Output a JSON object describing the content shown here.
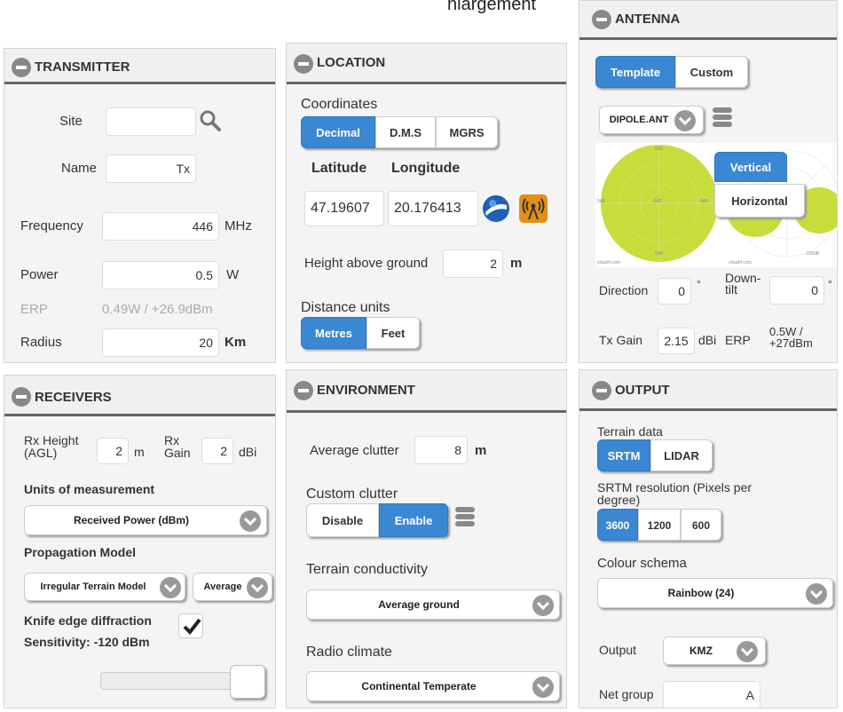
{
  "top_title": "nlargement",
  "transmitter": {
    "title": "TRANSMITTER",
    "site_label": "Site",
    "site_value": "",
    "name_label": "Name",
    "name_value": "Tx",
    "frequency_label": "Frequency",
    "frequency_value": "446",
    "frequency_unit": "MHz",
    "power_label": "Power",
    "power_value": "0.5",
    "power_unit": "W",
    "erp_label": "ERP",
    "erp_value": "0.49W / +26.9dBm",
    "radius_label": "Radius",
    "radius_value": "20",
    "radius_unit": "Km"
  },
  "location": {
    "title": "LOCATION",
    "coordinates_label": "Coordinates",
    "coord_modes": [
      "Decimal",
      "D.M.S",
      "MGRS"
    ],
    "coord_mode_selected": "Decimal",
    "latitude_label": "Latitude",
    "longitude_label": "Longitude",
    "latitude_value": "47.19607",
    "longitude_value": "20.176413",
    "height_label": "Height above ground",
    "height_value": "2",
    "height_unit": "m",
    "distance_label": "Distance units",
    "distance_modes": [
      "Metres",
      "Feet"
    ],
    "distance_selected": "Metres"
  },
  "antenna": {
    "title": "ANTENNA",
    "modes": [
      "Template",
      "Custom"
    ],
    "mode_selected": "Template",
    "template_value": "DIPOLE.ANT",
    "pattern_modes": [
      "Vertical",
      "Horizontal"
    ],
    "pattern_selected": "Vertical",
    "pattern_marks": {
      "left_top": "0dB",
      "left_side": "0dB",
      "left_center": "-0dB",
      "left_right": "0dB",
      "left_bottom": "0dB",
      "left_foot": "cloudrf.com",
      "right_side": "-100dB",
      "right_foot": "cloudrf.com"
    },
    "direction_label": "Direction",
    "direction_value": "0",
    "direction_unit": "°",
    "downtilt_label": "Down-\ntilt",
    "downtilt_value": "0",
    "downtilt_unit": "°",
    "gain_label": "Tx Gain",
    "gain_value": "2.15",
    "gain_unit": "dBi",
    "erp_label": "ERP",
    "erp_value": "0.5W /\n+27dBm"
  },
  "receivers": {
    "title": "RECEIVERS",
    "height_label": "Rx Height\n(AGL)",
    "height_value": "2",
    "height_unit": "m",
    "gain_label": "Rx\nGain",
    "gain_value": "2",
    "gain_unit": "dBi",
    "units_label": "Units of measurement",
    "units_value": "Received Power (dBm)",
    "model_label": "Propagation Model",
    "model_value": "Irregular Terrain Model",
    "model_mode": "Average",
    "knife_label": "Knife edge diffraction",
    "knife_checked": true,
    "sensitivity_label": "Sensitivity: -120 dBm",
    "sensitivity_slider_fraction": 1.0
  },
  "environment": {
    "title": "ENVIRONMENT",
    "clutter_label": "Average clutter",
    "clutter_value": "8",
    "clutter_unit": "m",
    "custom_label": "Custom clutter",
    "custom_modes": [
      "Disable",
      "Enable"
    ],
    "custom_selected": "Enable",
    "conductivity_label": "Terrain conductivity",
    "conductivity_value": "Average ground",
    "climate_label": "Radio climate",
    "climate_value": "Continental Temperate"
  },
  "output": {
    "title": "OUTPUT",
    "terrain_label": "Terrain data",
    "terrain_modes": [
      "SRTM",
      "LIDAR"
    ],
    "terrain_selected": "SRTM",
    "resolution_label": "SRTM resolution (Pixels per\ndegree)",
    "resolution_modes": [
      "3600",
      "1200",
      "600"
    ],
    "resolution_selected": "3600",
    "colour_label": "Colour schema",
    "colour_value": "Rainbow (24)",
    "output_label": "Output",
    "output_value": "KMZ",
    "netgroup_label": "Net group",
    "netgroup_value": "A"
  },
  "colors": {
    "accent": "#3a87d3",
    "panel": "#f4f4f4",
    "pattern_green": "#c8dc3c"
  },
  "icons": {
    "search": "search-icon",
    "globe": "google-earth-globe-icon",
    "tower": "radio-tower-icon",
    "list": "list-icon",
    "check": "checkmark-icon",
    "minus": "collapse-minus-icon",
    "chevron": "chevron-down-icon"
  }
}
